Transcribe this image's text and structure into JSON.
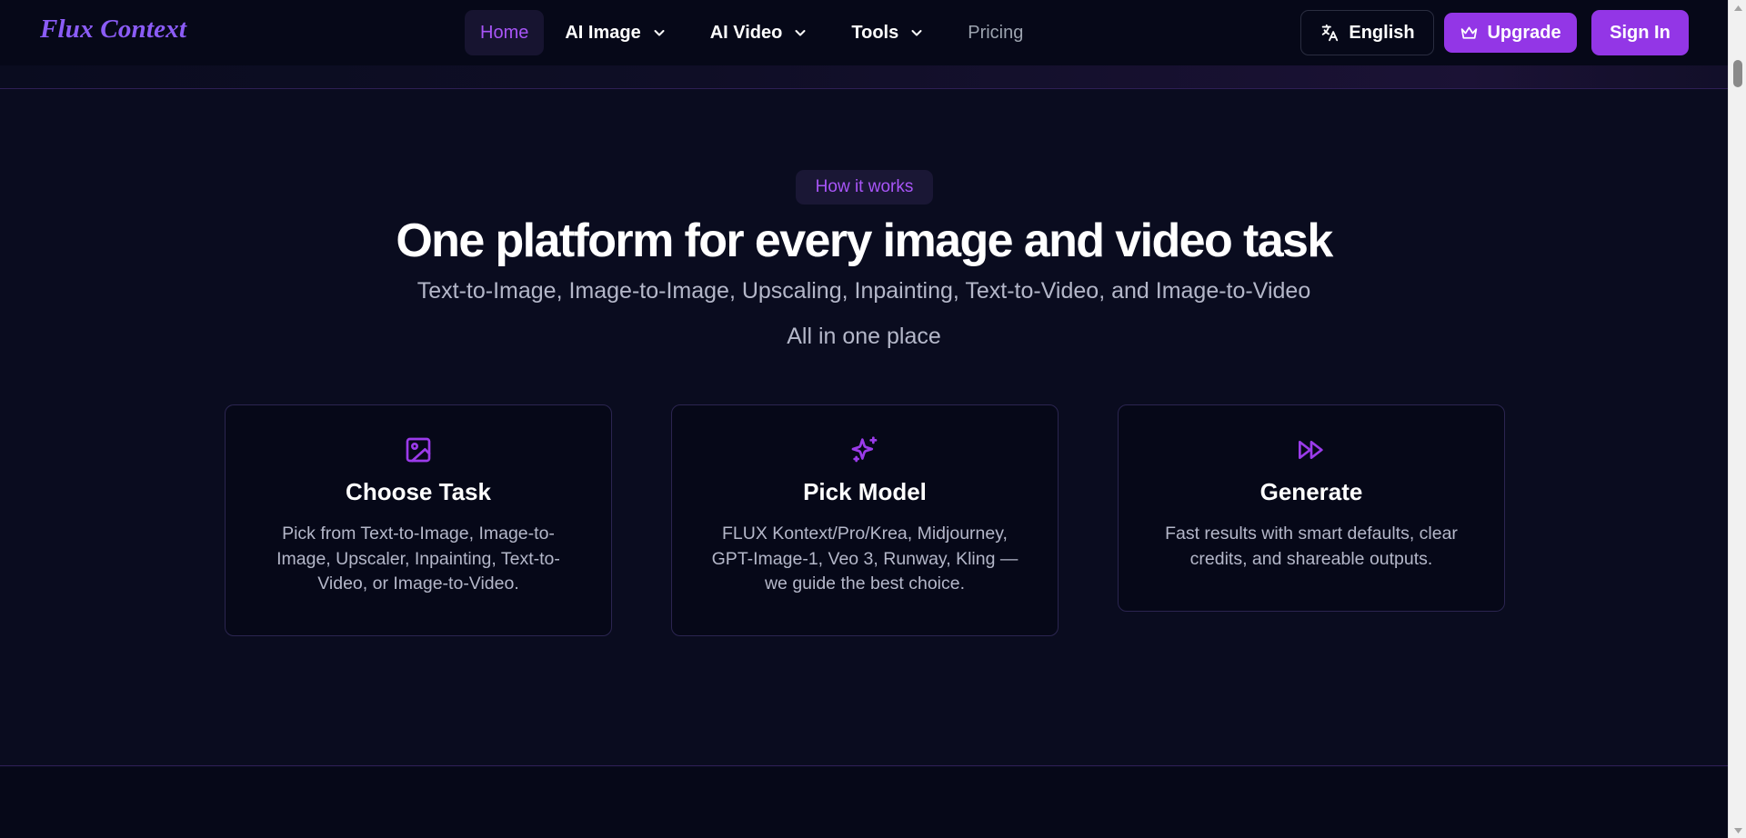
{
  "header": {
    "logo": "Flux Context",
    "nav": [
      {
        "label": "Home",
        "state": "active"
      },
      {
        "label": "AI Image",
        "dropdown": true
      },
      {
        "label": "AI Video",
        "dropdown": true
      },
      {
        "label": "Tools",
        "dropdown": true
      },
      {
        "label": "Pricing"
      }
    ],
    "language_button": "English",
    "upgrade_button": "Upgrade",
    "signin_button": "Sign In"
  },
  "section": {
    "badge": "How it works",
    "title": "One platform for every image and video task",
    "subtitle": "Text-to-Image, Image-to-Image, Upscaling, Inpainting, Text-to-Video, and Image-to-Video",
    "subtitle2": "All in one place",
    "cards": [
      {
        "icon": "image-icon",
        "title": "Choose Task",
        "description": "Pick from Text-to-Image, Image-to-Image, Upscaler, Inpainting, Text-to-Video, or Image-to-Video."
      },
      {
        "icon": "sparkles-icon",
        "title": "Pick Model",
        "description": "FLUX Kontext/Pro/Krea, Midjourney, GPT-Image-1, Veo 3, Runway, Kling — we guide the best choice."
      },
      {
        "icon": "fast-forward-icon",
        "title": "Generate",
        "description": "Fast results with smart defaults, clear credits, and shareable outputs."
      }
    ]
  },
  "colors": {
    "background": "#0a0c1f",
    "header": "#060818",
    "accent": "#9336e6",
    "accent_text": "#a855f7",
    "muted_text": "#b4b7c9"
  }
}
